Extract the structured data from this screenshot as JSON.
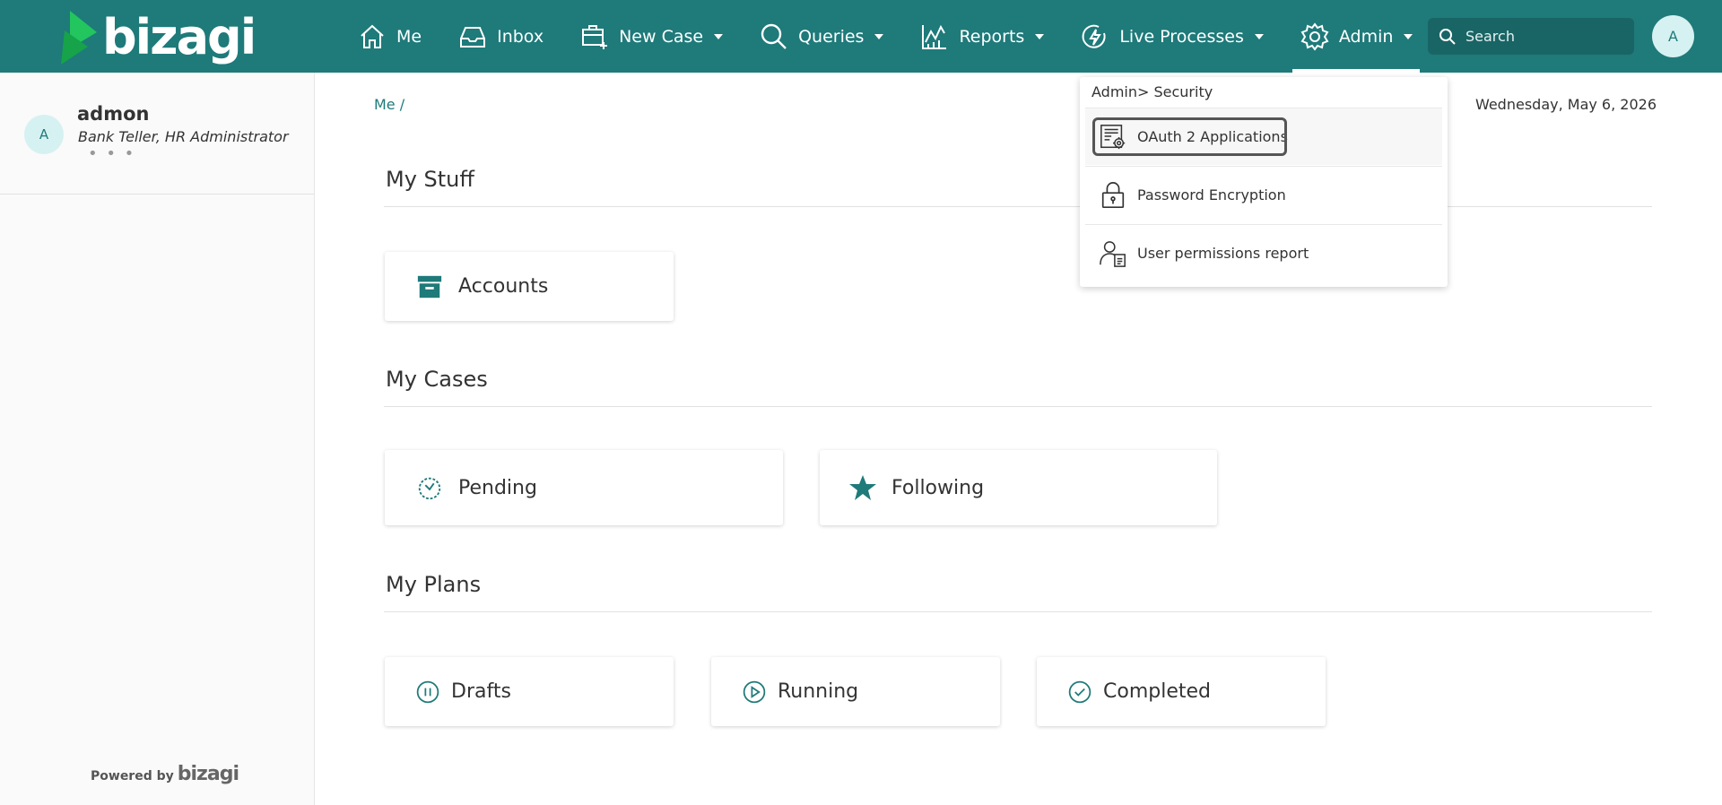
{
  "header": {
    "logo_text": "bizagi",
    "nav": [
      {
        "label": "Me",
        "icon": "home-icon",
        "has_caret": false
      },
      {
        "label": "Inbox",
        "icon": "inbox-icon",
        "has_caret": false
      },
      {
        "label": "New Case",
        "icon": "new-case-icon",
        "has_caret": true
      },
      {
        "label": "Queries",
        "icon": "search-icon",
        "has_caret": true
      },
      {
        "label": "Reports",
        "icon": "reports-chart-icon",
        "has_caret": true
      },
      {
        "label": "Live Processes",
        "icon": "lightning-icon",
        "has_caret": true
      },
      {
        "label": "Admin",
        "icon": "gear-icon",
        "has_caret": true,
        "active": true
      }
    ],
    "search_placeholder": "Search",
    "avatar_initial": "A"
  },
  "sidebar": {
    "avatar_initial": "A",
    "user_name": "admon",
    "user_roles": "Bank Teller, HR Administrator",
    "more": "• • •",
    "powered_by": "Powered by",
    "powered_logo": "bizagi"
  },
  "main": {
    "breadcrumb": "Me /",
    "date": "Wednesday, May 6, 2026",
    "sections": [
      {
        "title": "My Stuff",
        "cards": [
          {
            "label": "Accounts",
            "icon": "archive-box-icon"
          }
        ]
      },
      {
        "title": "My Cases",
        "cards": [
          {
            "label": "Pending",
            "icon": "clock-icon"
          },
          {
            "label": "Following",
            "icon": "star-icon"
          }
        ]
      },
      {
        "title": "My Plans",
        "cards": [
          {
            "label": "Drafts",
            "icon": "pause-circle-icon"
          },
          {
            "label": "Running",
            "icon": "play-circle-icon"
          },
          {
            "label": "Completed",
            "icon": "check-circle-icon"
          }
        ]
      }
    ]
  },
  "admin_menu": {
    "header": "Admin> Security",
    "items": [
      {
        "label": "OAuth 2 Applications",
        "icon": "oauth-app-icon"
      },
      {
        "label": "Password Encryption",
        "icon": "padlock-icon"
      },
      {
        "label": "User permissions report",
        "icon": "user-report-icon"
      }
    ]
  },
  "colors": {
    "brand_teal": "#1f7a7a",
    "logo_green": "#1fb35a",
    "avatar_bg": "#d6f1f1"
  }
}
